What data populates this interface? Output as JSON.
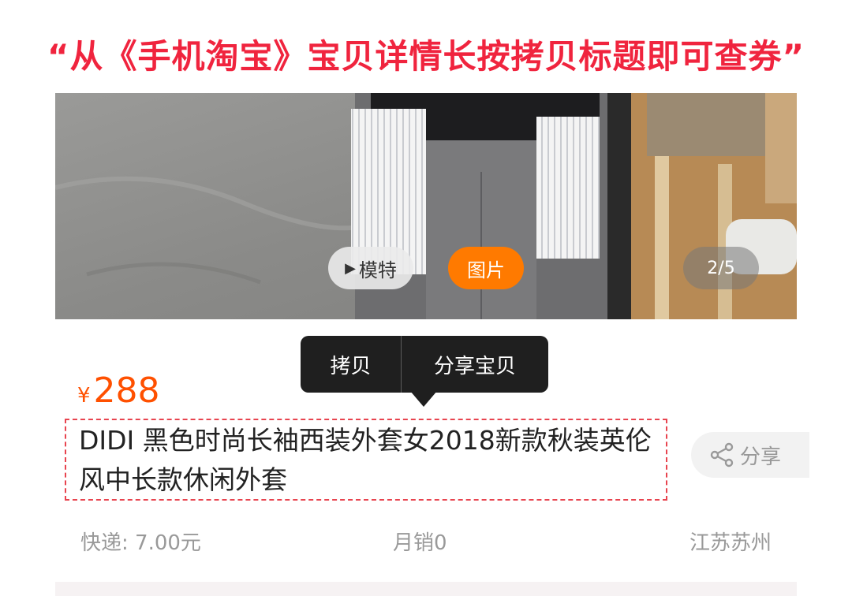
{
  "banner": {
    "text": "“从《手机淘宝》宝贝详情长按拷贝标题即可查券”"
  },
  "gallery": {
    "model_label": "模特",
    "photos_label": "图片",
    "counter": "2/5"
  },
  "context_menu": {
    "copy_label": "拷贝",
    "share_label": "分享宝贝"
  },
  "product": {
    "currency": "¥",
    "price": "288",
    "title": "DIDI  黑色时尚长袖西装外套女2018新款秋装英伦风中长款休闲外套",
    "share_label": "分享",
    "shipping": "快递: 7.00元",
    "monthly_sales": "月销0",
    "location": "江苏苏州"
  },
  "colors": {
    "banner": "#f0243e",
    "accent": "#ff7a00",
    "price": "#ff5000",
    "dashed_border": "#e8444f"
  },
  "icons": {
    "model_play": "play-icon",
    "share": "share-icon"
  }
}
